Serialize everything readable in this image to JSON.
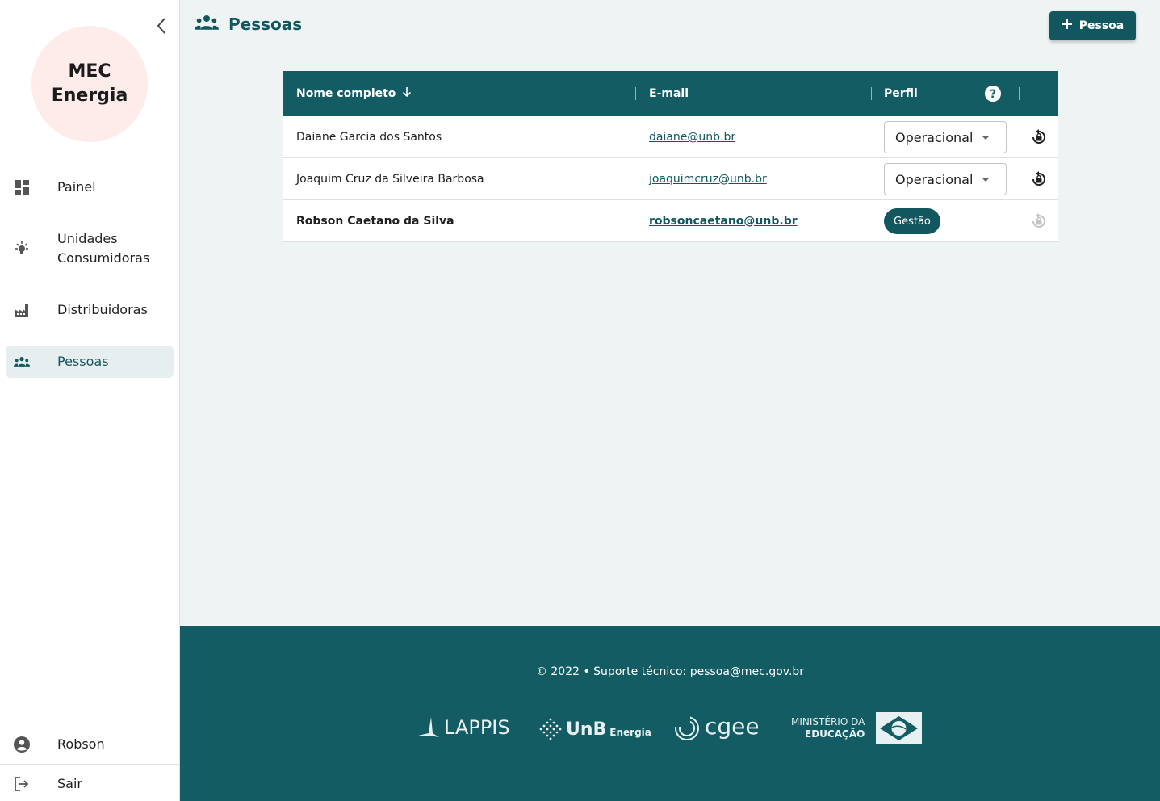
{
  "app": {
    "logo_text": "MEC Energia"
  },
  "sidebar": {
    "items": [
      {
        "label": "Painel",
        "icon": "dashboard-icon"
      },
      {
        "label": "Unidades Consumidoras",
        "icon": "lightbulb-icon"
      },
      {
        "label": "Distribuidoras",
        "icon": "factory-icon"
      },
      {
        "label": "Pessoas",
        "icon": "people-icon",
        "active": true
      }
    ],
    "user": {
      "label": "Robson",
      "icon": "account-circle-icon"
    },
    "logout": {
      "label": "Sair",
      "icon": "logout-icon"
    }
  },
  "header": {
    "title": "Pessoas",
    "add_button_label": "Pessoa"
  },
  "table": {
    "columns": {
      "name": "Nome completo",
      "email": "E-mail",
      "profile": "Perfil"
    },
    "sort": {
      "column": "Nome completo",
      "direction": "desc"
    },
    "rows": [
      {
        "name": "Daiane Garcia dos Santos",
        "email": "daiane@unb.br",
        "profile": "Operacional",
        "editable": true
      },
      {
        "name": "Joaquim Cruz da Silveira Barbosa",
        "email": "joaquimcruz@unb.br",
        "profile": "Operacional",
        "editable": true
      },
      {
        "name": "Robson Caetano da Silva",
        "email": "robsoncaetano@unb.br",
        "profile": "Gestão",
        "editable": false
      }
    ]
  },
  "footer": {
    "text": "© 2022  •  Suporte técnico: pessoa@mec.gov.br",
    "logos": {
      "lappis": "LAPPIS",
      "unb": "UnB",
      "unb_sub": "Energia",
      "cgee": "cgee",
      "mec_line1": "MINISTÉRIO DA",
      "mec_line2": "EDUCAÇÃO"
    }
  },
  "colors": {
    "primary": "#12575f",
    "header_bg": "#135c64",
    "page_bg": "#eef3f3",
    "logo_bg": "#fdecea"
  }
}
